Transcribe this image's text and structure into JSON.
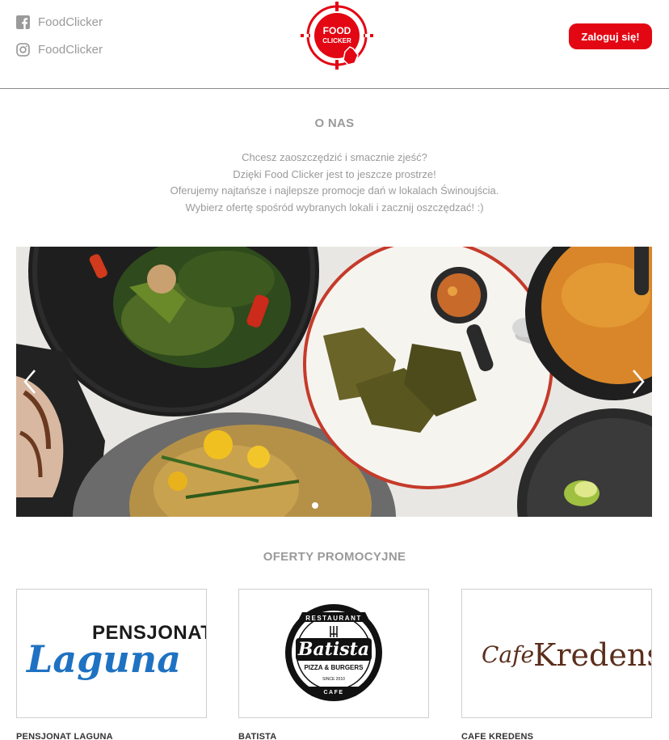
{
  "header": {
    "facebook_label": "FoodClicker",
    "instagram_label": "FoodClicker",
    "logo_text_line1": "FOOD",
    "logo_text_line2": "CLICKER",
    "login_label": "Zaloguj się!"
  },
  "about": {
    "title": "O NAS",
    "lines": [
      "Chcesz zaoszczędzić i smacznie zjeść?",
      "Dzięki Food Clicker jest to jeszcze prostrze!",
      "Oferujemy najtańsze i najlepsze promocje dań w lokalach Świnoujścia.",
      "Wybierz ofertę spośród wybranych lokali i zacznij oszczędzać! :)"
    ]
  },
  "carousel": {
    "prev_icon": "chevron-left-icon",
    "next_icon": "chevron-right-icon"
  },
  "offers": {
    "title": "OFERTY PROMOCYJNE",
    "items": [
      {
        "name": "PENSJONAT LAGUNA",
        "logo_top": "PENSJONAT",
        "logo_script": "Laguna"
      },
      {
        "name": "BATISTA",
        "logo_top": "RESTAURANT",
        "logo_script": "Batista",
        "logo_sub": "PIZZA & BURGERS",
        "logo_since": "SINCE 2010",
        "logo_bottom": "CAFE"
      },
      {
        "name": "CAFE KREDENS",
        "logo_cafe": "Cafe",
        "logo_main": "Kredens"
      }
    ]
  },
  "colors": {
    "brand_red": "#e30613",
    "muted_text": "#9a9a9a",
    "laguna_blue": "#1f72c2",
    "kredens_brown": "#5a2e1c"
  }
}
